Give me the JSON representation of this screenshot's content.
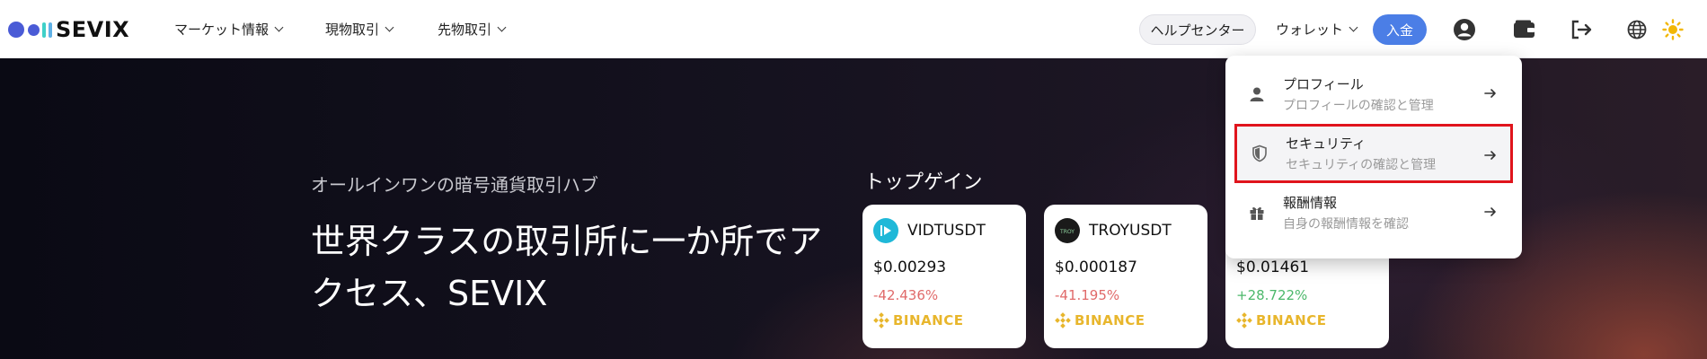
{
  "brand": {
    "name": "SEVIX"
  },
  "nav": {
    "market": "マーケット情報",
    "spot": "現物取引",
    "futures": "先物取引",
    "help": "ヘルプセンター",
    "wallet": "ウォレット",
    "deposit": "入金"
  },
  "header_icons": [
    "account-icon",
    "wallet-icon",
    "logout-icon",
    "globe-icon",
    "theme-sun-icon"
  ],
  "hero": {
    "subtitle": "オールインワンの暗号通貨取引ハブ",
    "title": "世界クラスの取引所に一か所でアクセス、SEVIX"
  },
  "top_gainers": {
    "title": "トップゲイン",
    "cards": [
      {
        "symbol": "VIDTUSDT",
        "price": "$0.00293",
        "change": "-42.436%",
        "exchange": "BINANCE"
      },
      {
        "symbol": "TROYUSDT",
        "price": "$0.000187",
        "change": "-41.195%",
        "exchange": "BINANCE"
      },
      {
        "symbol": "",
        "price": "$0.01461",
        "change": "+28.722%",
        "exchange": "BINANCE"
      }
    ]
  },
  "account_menu": {
    "items": [
      {
        "title": "プロフィール",
        "desc": "プロフィールの確認と管理",
        "icon": "user-icon"
      },
      {
        "title": "セキュリティ",
        "desc": "セキュリティの確認と管理",
        "icon": "shield-icon",
        "highlighted": true
      },
      {
        "title": "報酬情報",
        "desc": "自身の報酬情報を確認",
        "icon": "gift-icon"
      }
    ]
  },
  "colors": {
    "accent": "#4b7ee6",
    "negative": "#e06a6a",
    "positive": "#4cb86b",
    "binance": "#e8b62c",
    "highlight_border": "#e0141c"
  }
}
